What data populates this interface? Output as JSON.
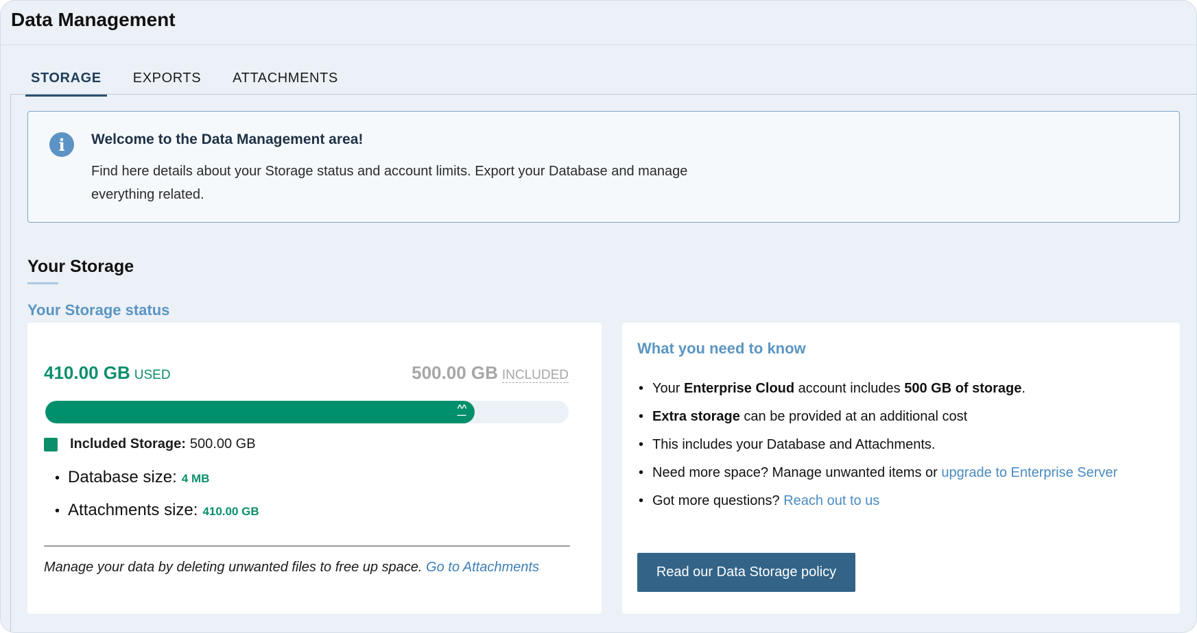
{
  "header": {
    "title": "Data Management"
  },
  "tabs": [
    {
      "label": "STORAGE",
      "active": true
    },
    {
      "label": "EXPORTS",
      "active": false
    },
    {
      "label": "ATTACHMENTS",
      "active": false
    }
  ],
  "info": {
    "icon": "info-icon",
    "title": "Welcome to the Data Management area!",
    "text": "Find here details about your Storage status and account limits. Export your Database and manage everything related."
  },
  "storage": {
    "heading": "Your Storage",
    "status_label": "Your Storage status",
    "used_value": "410.00 GB",
    "used_unit": "USED",
    "included_value": "500.00 GB",
    "included_unit": "INCLUDED",
    "progress_fraction": 0.82,
    "legend_label": "Included Storage:",
    "legend_value": "500.00 GB",
    "sizes": [
      {
        "label": "Database size:",
        "value": "4 MB"
      },
      {
        "label": "Attachments size:",
        "value": "410.00 GB"
      }
    ],
    "manage_note": "Manage your data by deleting unwanted files to free up space.",
    "manage_link": "Go to Attachments"
  },
  "know": {
    "title": "What you need to know",
    "item1_pre": "Your ",
    "item1_bold1": "Enterprise Cloud",
    "item1_mid": " account includes ",
    "item1_bold2": "500 GB of storage",
    "item1_post": ".",
    "item2_bold": "Extra storage",
    "item2_rest": " can be provided at an additional cost",
    "item3": "This includes your Database and Attachments.",
    "item4_pre": "Need more space? Manage unwanted items or ",
    "item4_link": "upgrade to Enterprise Server",
    "item5_pre": "Got more questions? ",
    "item5_link": "Reach out to us",
    "button_label": "Read our Data Storage policy"
  },
  "colors": {
    "accent_green": "#008f6c",
    "accent_blue": "#5a95c3",
    "button_blue": "#336488"
  }
}
